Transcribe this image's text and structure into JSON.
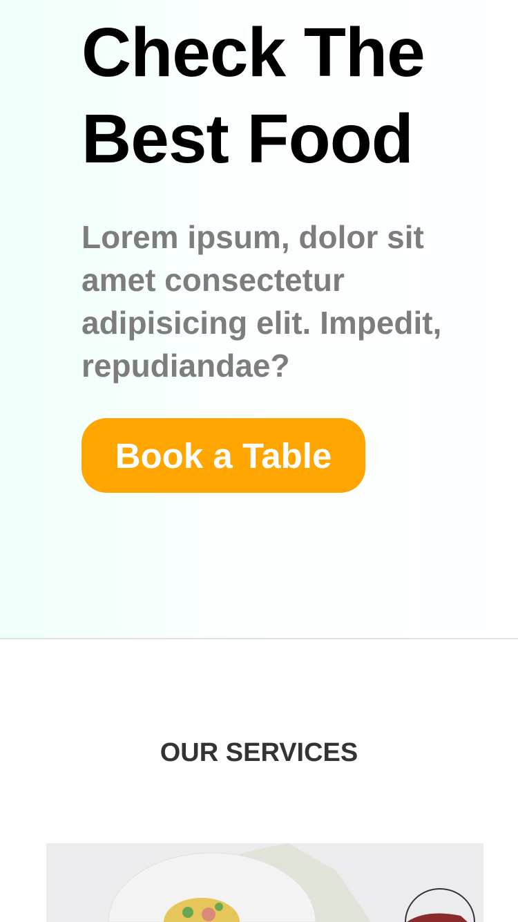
{
  "hero": {
    "title_line1": "Check The",
    "title_line2": "Best Food",
    "subtitle": "Lorem ipsum, dolor sit amet consectetur adipisicing elit. Impedit, repudiandae?",
    "cta": "Book a Table"
  },
  "services": {
    "heading": "OUR SERVICES"
  },
  "colors": {
    "accent": "#ffa500",
    "hero_tint": "#effffa"
  }
}
